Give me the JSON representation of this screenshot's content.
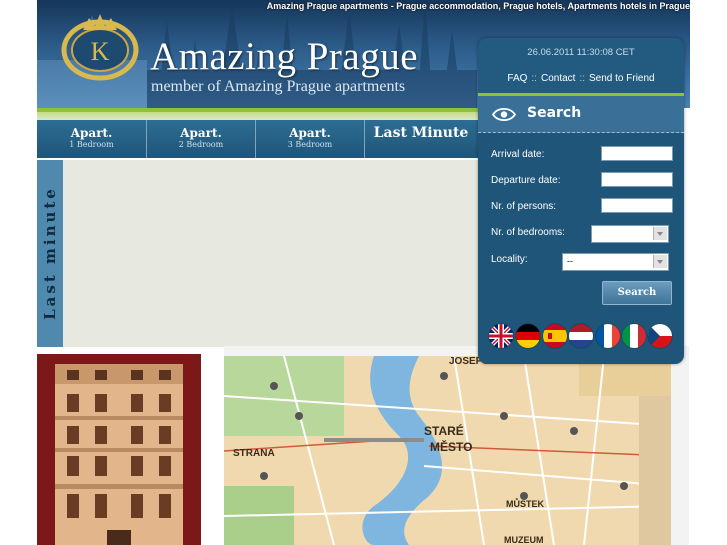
{
  "header": {
    "tagline": "Amazing Prague apartments - Prague accommodation, Prague hotels, Apartments hotels in Prague",
    "title": "Amazing Prague",
    "subtitle": "member of Amazing Prague apartments"
  },
  "nav": {
    "items": [
      {
        "label": "Apart.",
        "sub": "1 Bedroom"
      },
      {
        "label": "Apart.",
        "sub": "2 Bedroom"
      },
      {
        "label": "Apart.",
        "sub": "3 Bedroom"
      },
      {
        "label": "Last Minute",
        "sub": ""
      }
    ]
  },
  "side_panel": {
    "vertical_label": "Last minute"
  },
  "search_panel": {
    "datetime": "26.06.2011 11:30:08 CET",
    "links": [
      "FAQ",
      "Contact",
      "Send to Friend"
    ],
    "separator": "::",
    "title": "Search",
    "fields": {
      "arrival_label": "Arrival date:",
      "arrival_value": "",
      "departure_label": "Departure date:",
      "departure_value": "",
      "persons_label": "Nr. of persons:",
      "persons_value": "",
      "bedrooms_label": "Nr. of bedrooms:",
      "bedrooms_value": "",
      "locality_label": "Locality:",
      "locality_value": "--"
    },
    "button_label": "Search",
    "languages": [
      "english-flag",
      "german-flag",
      "spanish-flag",
      "dutch-flag",
      "french-flag",
      "italian-flag",
      "czech-flag"
    ]
  },
  "map": {
    "labels": [
      "JOSEFOV",
      "STRANA",
      "STARÉ",
      "MĚSTO",
      "MŮSTEK",
      "MUZEUM"
    ]
  },
  "colors": {
    "panel_blue": "#1f5578",
    "accent_green": "#8fc23a",
    "header_blue": "#2d5d8b"
  }
}
